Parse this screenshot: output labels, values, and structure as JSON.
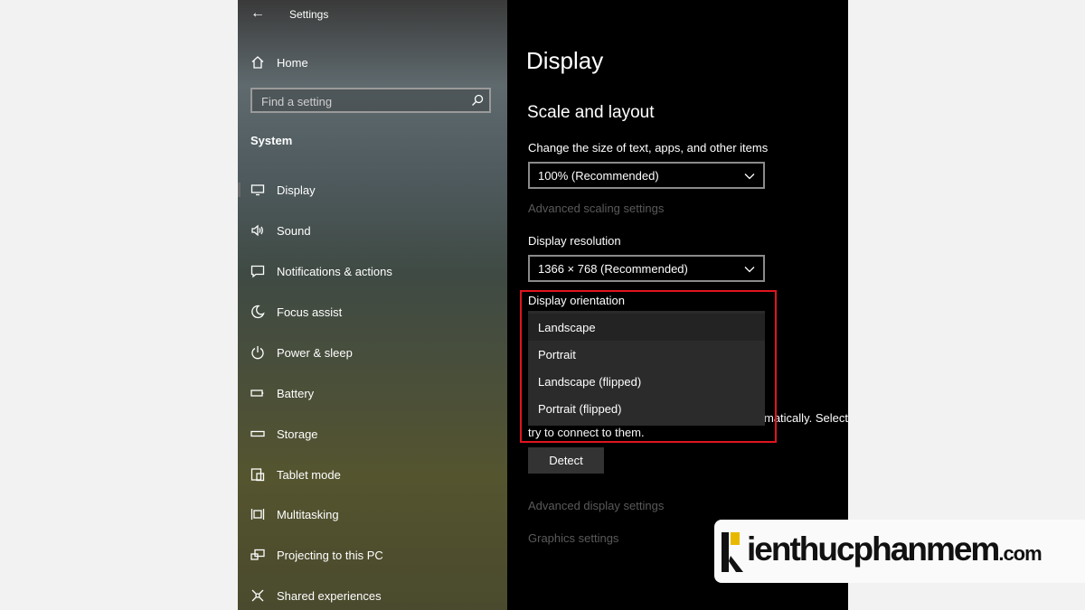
{
  "window": {
    "title": "Settings"
  },
  "sidebar": {
    "home_label": "Home",
    "search_placeholder": "Find a setting",
    "section_label": "System",
    "items": [
      {
        "label": "Display",
        "icon": "monitor-icon",
        "active": true
      },
      {
        "label": "Sound",
        "icon": "speaker-icon"
      },
      {
        "label": "Notifications & actions",
        "icon": "notification-icon"
      },
      {
        "label": "Focus assist",
        "icon": "moon-icon"
      },
      {
        "label": "Power & sleep",
        "icon": "power-icon"
      },
      {
        "label": "Battery",
        "icon": "battery-icon"
      },
      {
        "label": "Storage",
        "icon": "storage-icon"
      },
      {
        "label": "Tablet mode",
        "icon": "tablet-mode-icon"
      },
      {
        "label": "Multitasking",
        "icon": "multitasking-icon"
      },
      {
        "label": "Projecting to this PC",
        "icon": "projecting-icon"
      },
      {
        "label": "Shared experiences",
        "icon": "shared-experiences-icon"
      }
    ]
  },
  "main": {
    "title": "Display",
    "section_title": "Scale and layout",
    "scale_label": "Change the size of text, apps, and other items",
    "scale_value": "100% (Recommended)",
    "advanced_scaling_link": "Advanced scaling settings",
    "resolution_label": "Display resolution",
    "resolution_value": "1366 × 768 (Recommended)",
    "orientation_label": "Display orientation",
    "orientation_options": [
      {
        "label": "Landscape",
        "selected": true
      },
      {
        "label": "Portrait"
      },
      {
        "label": "Landscape (flipped)"
      },
      {
        "label": "Portrait (flipped)"
      }
    ],
    "multiple_displays_text_fragment": "matically. Select",
    "multiple_displays_text_line2": "try to connect to them.",
    "detect_button": "Detect",
    "advanced_display_link": "Advanced display settings",
    "graphics_link": "Graphics settings"
  },
  "watermark": {
    "brand": "ienthucphanmem",
    "tld": ".com"
  },
  "colors": {
    "highlight": "#e0141e",
    "main_bg": "#000000",
    "accent_dim": "#5a5a5a"
  }
}
